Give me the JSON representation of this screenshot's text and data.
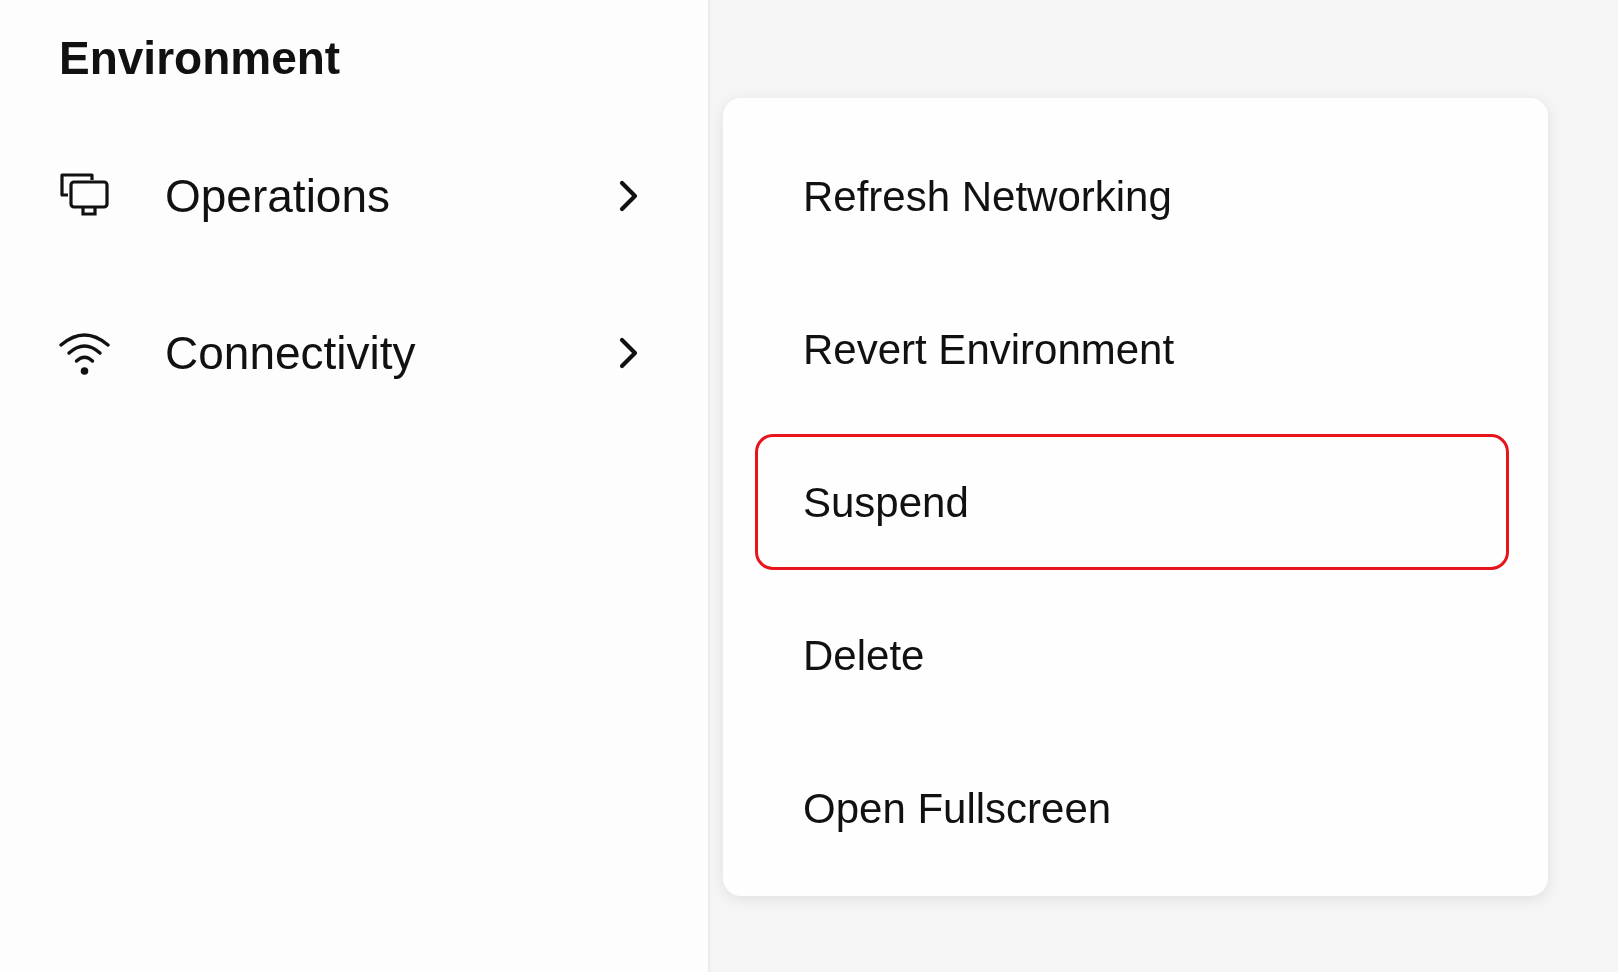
{
  "sidebar": {
    "title": "Environment",
    "items": [
      {
        "label": "Operations"
      },
      {
        "label": "Connectivity"
      }
    ]
  },
  "menu": {
    "items": [
      {
        "label": "Refresh Networking",
        "selected": false
      },
      {
        "label": "Revert Environment",
        "selected": false
      },
      {
        "label": "Suspend",
        "selected": true
      },
      {
        "label": "Delete",
        "selected": false
      },
      {
        "label": "Open Fullscreen",
        "selected": false
      }
    ]
  }
}
